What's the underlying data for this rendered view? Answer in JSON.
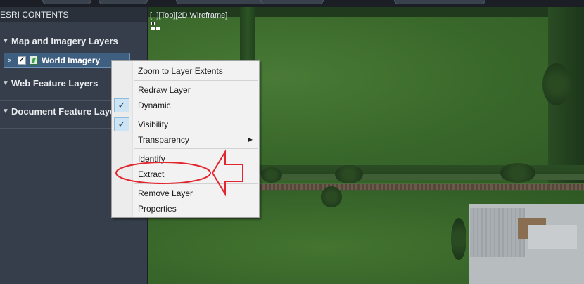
{
  "sidebar": {
    "header": "ESRI CONTENTS",
    "groups": [
      {
        "label": "Map and Imagery Layers",
        "chevron": "▼"
      },
      {
        "label": "Web Feature Layers",
        "chevron": "▼"
      },
      {
        "label": "Document Feature Layers",
        "chevron": "▼"
      }
    ],
    "layer": {
      "label": "World Imagery",
      "expand": ">",
      "checked": "✓"
    }
  },
  "viewport": {
    "label": "[−][Top][2D Wireframe]",
    "ucs_icon": "ucs-icon"
  },
  "context_menu": {
    "items": [
      {
        "label": "Zoom to Layer Extents"
      },
      {
        "label": "Redraw Layer"
      },
      {
        "label": "Dynamic",
        "check": "✓"
      },
      {
        "label": "Visibility",
        "check": "✓"
      },
      {
        "label": "Transparency",
        "submenu": "▶"
      },
      {
        "label": "Identify"
      },
      {
        "label": "Extract"
      },
      {
        "label": "Remove Layer"
      },
      {
        "label": "Properties"
      }
    ]
  },
  "annotation": {
    "color": "#e3262e"
  }
}
